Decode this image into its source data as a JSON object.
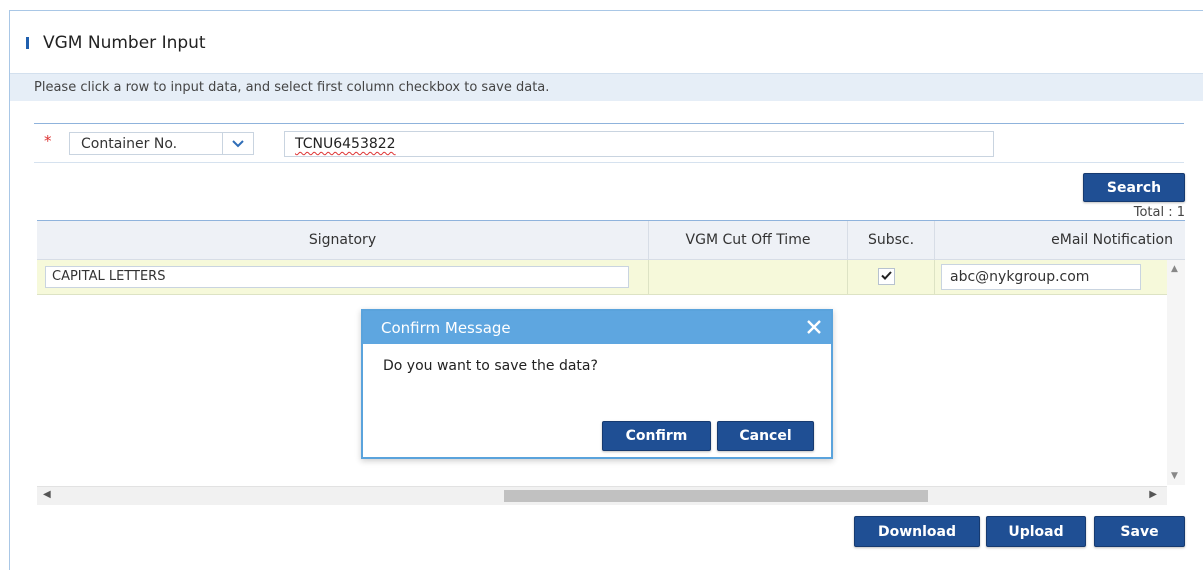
{
  "page": {
    "title": "VGM Number Input",
    "notice": "Please click a row to input data, and select first column checkbox to save data."
  },
  "search": {
    "required_mark": "*",
    "field_select": "Container No.",
    "field_value": "TCNU6453822",
    "search_label": "Search",
    "total_label": "Total : 1"
  },
  "grid": {
    "columns": [
      "Signatory",
      "VGM Cut Off Time",
      "Subsc.",
      "eMail Notification"
    ],
    "rows": [
      {
        "signatory": "CAPITAL LETTERS",
        "vgm_cut_off_time": "",
        "subscribed": true,
        "email": "abc@nykgroup.com"
      }
    ]
  },
  "dialog": {
    "title": "Confirm Message",
    "message": "Do you want to save the data?",
    "confirm_label": "Confirm",
    "cancel_label": "Cancel"
  },
  "actions": {
    "download_label": "Download",
    "upload_label": "Upload",
    "save_label": "Save"
  },
  "icons": {
    "dropdown": "chevron-down-icon",
    "close": "close-icon",
    "check": "check-icon"
  },
  "colors": {
    "primary_button": "#1f4f94",
    "dialog_header": "#5ea6e0",
    "row_highlight": "#f6f9da"
  }
}
